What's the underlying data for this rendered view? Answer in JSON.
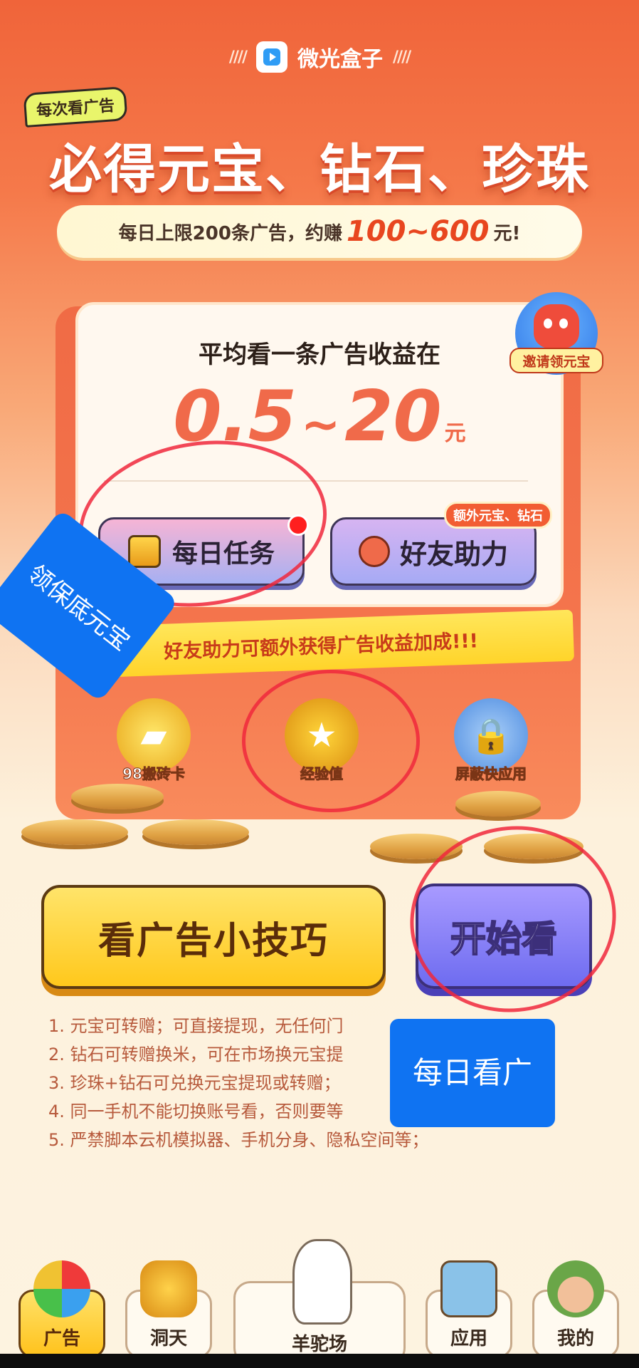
{
  "brand": {
    "name": "微光盒子",
    "logo_icon": "play-icon"
  },
  "tag": "每次看广告",
  "headline": "必得元宝、钻石、珍珠",
  "limit": {
    "prefix": "每日上限200条广告，约赚",
    "range": "100~600",
    "suffix": "元!"
  },
  "invite": {
    "label": "邀请领元宝",
    "icon": "hand-mascot-icon"
  },
  "card": {
    "title": "平均看一条广告收益在",
    "value_min": "0.5",
    "tilde": "~",
    "value_max": "20",
    "unit": "元"
  },
  "buttons": {
    "daily_task": "每日任务",
    "friend_help": "好友助力",
    "extra_badge": "额外元宝、钻石",
    "tips": "看广告小技巧",
    "start": "开始看"
  },
  "ribbon": "好友助力可额外获得广告收益加成!!!",
  "features": [
    {
      "label": "98搬砖卡",
      "icon": "card-icon"
    },
    {
      "label": "经验值",
      "icon": "star-badge-icon"
    },
    {
      "label": "屏蔽快应用",
      "icon": "shield-lock-icon"
    }
  ],
  "rules": [
    "1. 元宝可转赠；可直接提现，无任何门",
    "2. 钻石可转赠换米，可在市场换元宝提",
    "3. 珍珠+钻石可兑换元宝提现或转赠；",
    "4. 同一手机不能切换账号看，否则要等",
    "5. 严禁脚本云机模拟器、手机分身、隐私空间等；"
  ],
  "overlays": {
    "left": "领保底元宝",
    "right": "每日看广"
  },
  "nav": [
    {
      "label": "广告",
      "icon": "color-wheel-icon",
      "active": true
    },
    {
      "label": "洞天",
      "icon": "crown-shield-icon",
      "active": false
    },
    {
      "label": "羊驼场",
      "icon": "alpaca-icon",
      "active": false
    },
    {
      "label": "应用",
      "icon": "map-icon",
      "active": false
    },
    {
      "label": "我的",
      "icon": "avatar-icon",
      "active": false
    }
  ],
  "colors": {
    "accent": "#f06a4a",
    "start_button": "#6e6cf0",
    "tips_button": "#ffc81c",
    "overlay": "#0f73f2"
  }
}
